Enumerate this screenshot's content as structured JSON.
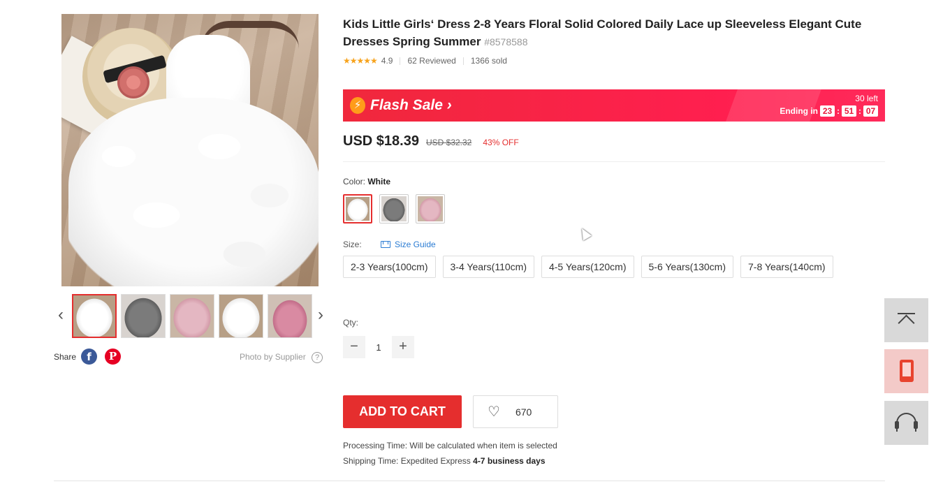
{
  "product": {
    "title": "Kids Little Girls‘ Dress 2-8 Years Floral Solid Colored Daily Lace up Sleeveless Elegant Cute Dresses Spring Summer",
    "sku": "#8578588",
    "stars": "★★★★★",
    "rating": "4.9",
    "reviews": "62 Reviewed",
    "sold": "1366 sold"
  },
  "gallery": {
    "prev_arrow": "‹",
    "next_arrow": "›",
    "thumbnails": [
      "white",
      "gray",
      "pink",
      "white",
      "pink"
    ],
    "share_label": "Share",
    "facebook_glyph": "f",
    "pinterest_glyph": "P",
    "photo_by": "Photo by Supplier",
    "help_glyph": "?"
  },
  "flash_sale": {
    "label": "Flash Sale",
    "chevron": "›",
    "bolt_glyph": "⚡",
    "left_count": "30 left",
    "ending_label": "Ending in",
    "hours": "23",
    "minutes": "51",
    "seconds": "07",
    "colon": ":"
  },
  "pricing": {
    "price": "USD $18.39",
    "old_price": "USD $32.32",
    "discount": "43% OFF"
  },
  "color": {
    "label": "Color:",
    "selected": "White",
    "options": [
      "white",
      "gray",
      "pink"
    ]
  },
  "size": {
    "label": "Size:",
    "guide_label": "Size Guide",
    "options": [
      "2-3 Years(100cm)",
      "3-4 Years(110cm)",
      "4-5 Years(120cm)",
      "5-6 Years(130cm)",
      "7-8 Years(140cm)"
    ]
  },
  "quantity": {
    "label": "Qty:",
    "minus": "−",
    "plus": "+",
    "value": "1"
  },
  "actions": {
    "add_to_cart": "ADD TO CART",
    "heart_glyph": "♡",
    "wishlist_count": "670"
  },
  "shipping": {
    "processing_label": "Processing Time:",
    "processing_value": "Will be calculated when item is selected",
    "shipping_label": "Shipping Time:",
    "shipping_value": "Expedited Express",
    "shipping_days": "4-7 business days"
  },
  "side_tools": [
    "back-to-top",
    "app-download",
    "customer-service"
  ],
  "colors": {
    "accent": "#e52e2e",
    "flash_bg": "#f0283c",
    "link": "#2b7cd3",
    "star": "#f7a31c"
  }
}
